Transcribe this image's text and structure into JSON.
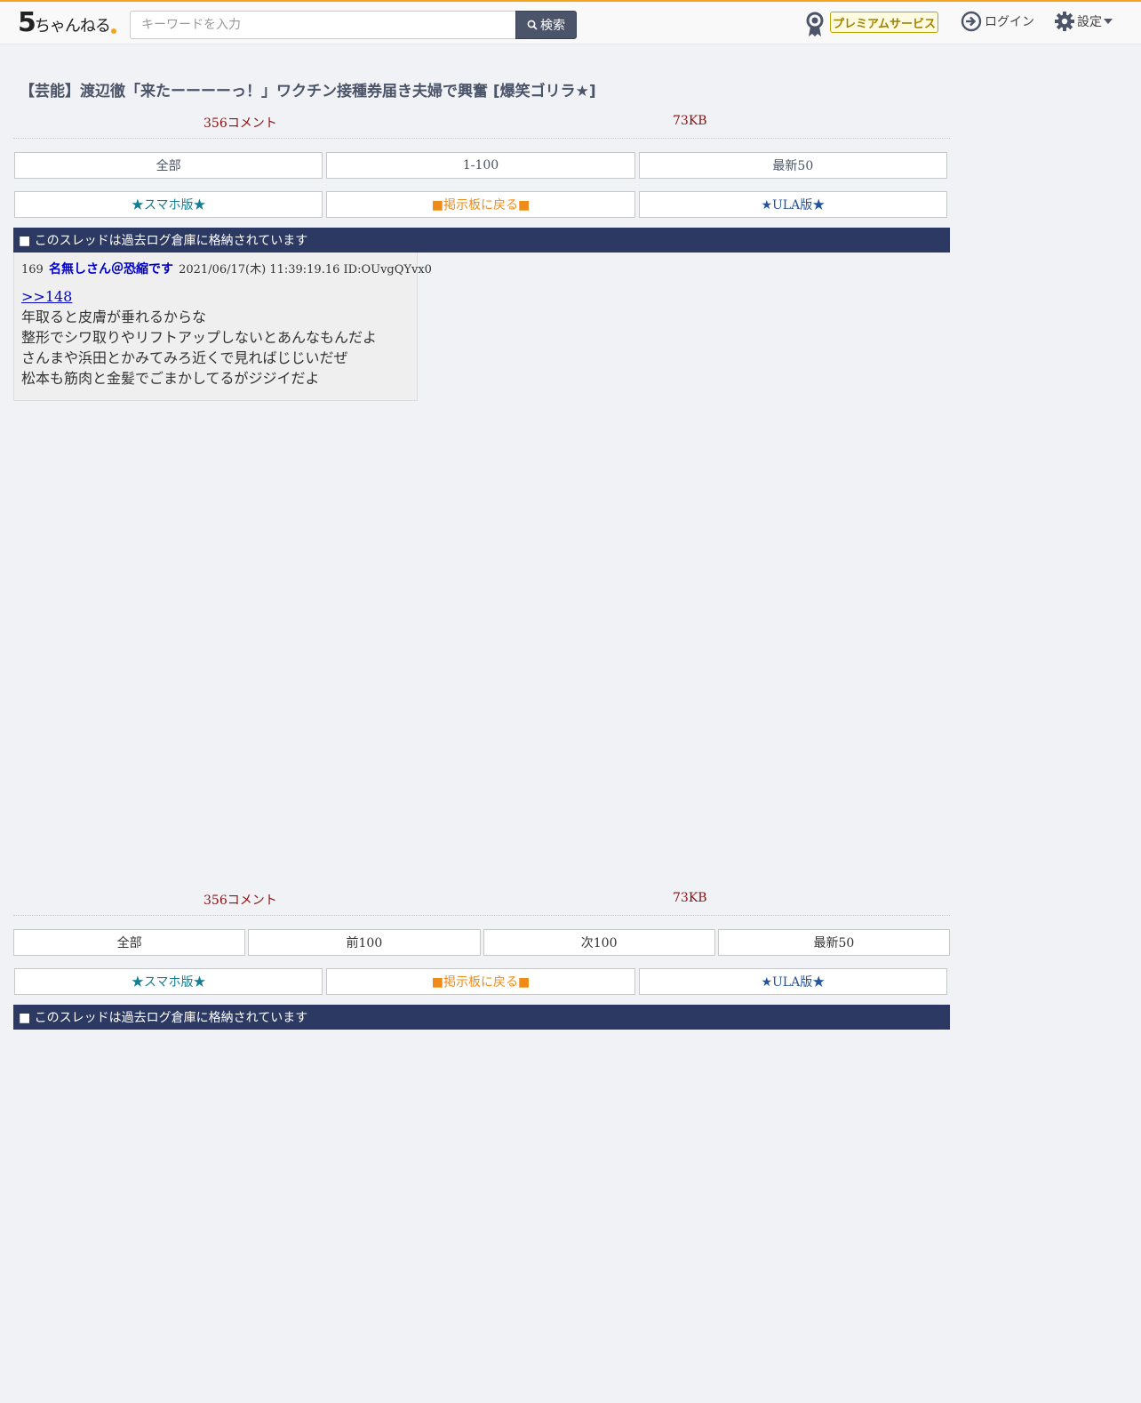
{
  "header": {
    "logo_main": "5",
    "logo_rest": "ちゃんねる",
    "search_placeholder": "キーワードを入力",
    "search_button": "検索",
    "premium": "プレミアムサービス",
    "login": "ログイン",
    "settings": "設定"
  },
  "thread": {
    "title": "【芸能】渡辺徹「来たーーーーっ！」ワクチン接種券届き夫婦で興奮 [爆笑ゴリラ★]",
    "comments": "356コメント",
    "size": "73KB",
    "archived_notice": "■ このスレッドは過去ログ倉庫に格納されています"
  },
  "nav_top": [
    "全部",
    "1-100",
    "最新50"
  ],
  "nav_bottom": [
    "全部",
    "前100",
    "次100",
    "最新50"
  ],
  "links": {
    "smartphone": "★スマホ版★",
    "board": "■掲示板に戻る■",
    "ula": "★ULA版★"
  },
  "post": {
    "number": "169",
    "name": "名無しさん＠恐縮です",
    "date": "2021/06/17(木) 11:39:19.16",
    "id": "ID:OUvgQYvx0",
    "anchor": ">>148",
    "lines": [
      "年取ると皮膚が垂れるからな",
      "整形でシワ取りやリフトアップしないとあんなもんだよ",
      "さんまや浜田とかみてみろ近くで見ればじじいだぜ",
      "松本も筋肉と金髪でごまかしてるがジジイだよ"
    ]
  },
  "colors": {
    "accent_top": "#f4a321",
    "archived_bar": "#2c3963",
    "count_text": "#8b1010",
    "name_text": "#0000c8"
  }
}
